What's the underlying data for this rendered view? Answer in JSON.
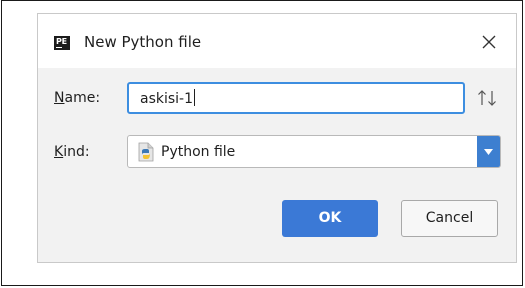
{
  "dialog": {
    "app_icon_text": "PE",
    "title": "New Python file",
    "close_glyph": "×"
  },
  "form": {
    "name": {
      "label_mnemonic": "N",
      "label_rest": "ame:",
      "value": "askisi-1"
    },
    "kind": {
      "label_mnemonic": "K",
      "label_rest": "ind:",
      "selected": "Python file",
      "icon": "python-file-icon"
    },
    "sort_icon": "sort-arrows-icon"
  },
  "buttons": {
    "ok_label": "OK",
    "cancel_label": "Cancel"
  },
  "colors": {
    "accent": "#3b79d6",
    "focus_border": "#3d8ee0",
    "dialog_bg": "#f2f2f2"
  }
}
